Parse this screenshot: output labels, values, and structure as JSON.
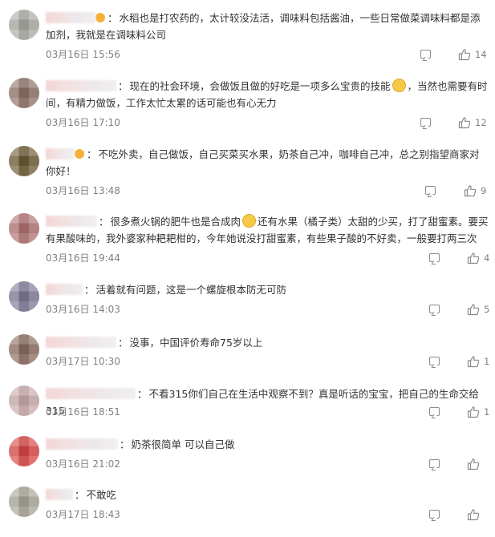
{
  "comments": [
    {
      "text": "水稻也是打农药的，太计较没法活，调味料包括酱油，一些日常做菜调味料都是添加剂，我就是在调味料公司",
      "time": "03月16日 15:56",
      "likes": "14",
      "avatar_color": "#a9a8a2"
    },
    {
      "text": "现在的社会环境，会做饭且做的好吃是一项多么宝贵的技能",
      "text2": "，当然也需要有时间，有精力做饭，工作太忙太累的话可能也有心无力",
      "time": "03月16日 17:10",
      "likes": "12",
      "avatar_color": "#8c6f64"
    },
    {
      "text": "不吃外卖，自己做饭，自己买菜买水果，奶茶自己冲，咖啡自己冲，总之别指望商家对你好！",
      "time": "03月16日 13:48",
      "likes": "9",
      "avatar_color": "#6b5a33"
    },
    {
      "text": "很多煮火锅的肥牛也是合成肉",
      "text2": "还有水果（橘子类）太甜的少买，打了甜蜜素。要买有果酸味的，我外婆家种耙耙柑的，今年她说没打甜蜜素，有些果子酸的不好卖，一般要打两三次",
      "time": "03月16日 19:44",
      "likes": "4",
      "avatar_color": "#b07070"
    },
    {
      "text": "活着就有问题，这是一个螺旋根本防无可防",
      "time": "03月16日 14:03",
      "likes": "5",
      "avatar_color": "#7c7896"
    },
    {
      "text": "没事，中国评价寿命75岁以上",
      "time": "03月17日 10:30",
      "likes": "1",
      "avatar_color": "#8a6a5e"
    },
    {
      "text": "不看315你们自己在生活中观察不到？真是听话的宝宝，把自己的生命交给315",
      "time": "03月16日 18:51",
      "likes": "1",
      "avatar_color": "#c9a9a9"
    },
    {
      "text": "奶茶很简单 可以自己做",
      "time": "03月16日 21:02",
      "likes": "",
      "avatar_color": "#d84545"
    },
    {
      "text": "不敢吃",
      "time": "03月17日 18:43",
      "likes": "",
      "avatar_color": "#a8a496"
    }
  ]
}
